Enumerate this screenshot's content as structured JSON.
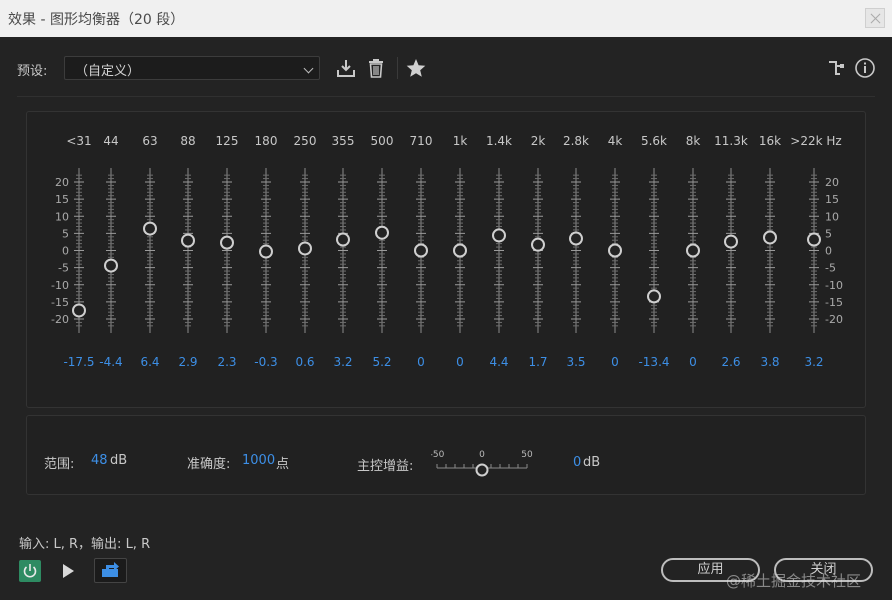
{
  "window": {
    "title": "效果 - 图形均衡器（20 段）"
  },
  "toolbar": {
    "preset_label": "预设:",
    "preset_value": "（自定义）",
    "icons": [
      "save-preset-icon",
      "delete-preset-icon",
      "favorite-star-icon",
      "routing-icon",
      "info-icon"
    ]
  },
  "eq": {
    "band_labels": [
      "<31",
      "44",
      "63",
      "88",
      "125",
      "180",
      "250",
      "355",
      "500",
      "710",
      "1k",
      "1.4k",
      "2k",
      "2.8k",
      "4k",
      "5.6k",
      "8k",
      "11.3k",
      "16k",
      ">22k Hz"
    ],
    "gains": [
      -17.5,
      -4.4,
      6.4,
      2.9,
      2.3,
      -0.3,
      0.6,
      3.2,
      5.2,
      0,
      0,
      4.4,
      1.7,
      3.5,
      0,
      -13.4,
      0,
      2.6,
      3.8,
      3.2
    ],
    "value_labels": [
      "-17.5",
      "-4.4",
      "6.4",
      "2.9",
      "2.3",
      "-0.3",
      "0.6",
      "3.2",
      "5.2",
      "0",
      "0",
      "4.4",
      "1.7",
      "3.5",
      "0",
      "-13.4",
      "0",
      "2.6",
      "3.8",
      "3.2"
    ],
    "scale_labels": [
      "20",
      "15",
      "10",
      "5",
      "0",
      "-5",
      "-10",
      "-15",
      "-20"
    ],
    "range": [
      -20,
      20
    ]
  },
  "settings": {
    "range_label": "范围:",
    "range_value": "48",
    "range_unit": "dB",
    "accuracy_label": "准确度:",
    "accuracy_value": "1000",
    "accuracy_unit": "点",
    "master_gain_label": "主控增益:",
    "master_gain_scale": [
      "-50",
      "0",
      "50"
    ],
    "master_gain_value": "0",
    "master_gain_unit": "dB",
    "master_gain_level": 0
  },
  "footer": {
    "io_text": "输入: L, R，输出: L, R",
    "apply_label": "应用",
    "close_label": "关闭",
    "watermark": "@稀土掘金技术社区"
  },
  "colors": {
    "accent": "#3d8fe6",
    "power": "#2e8b62"
  }
}
